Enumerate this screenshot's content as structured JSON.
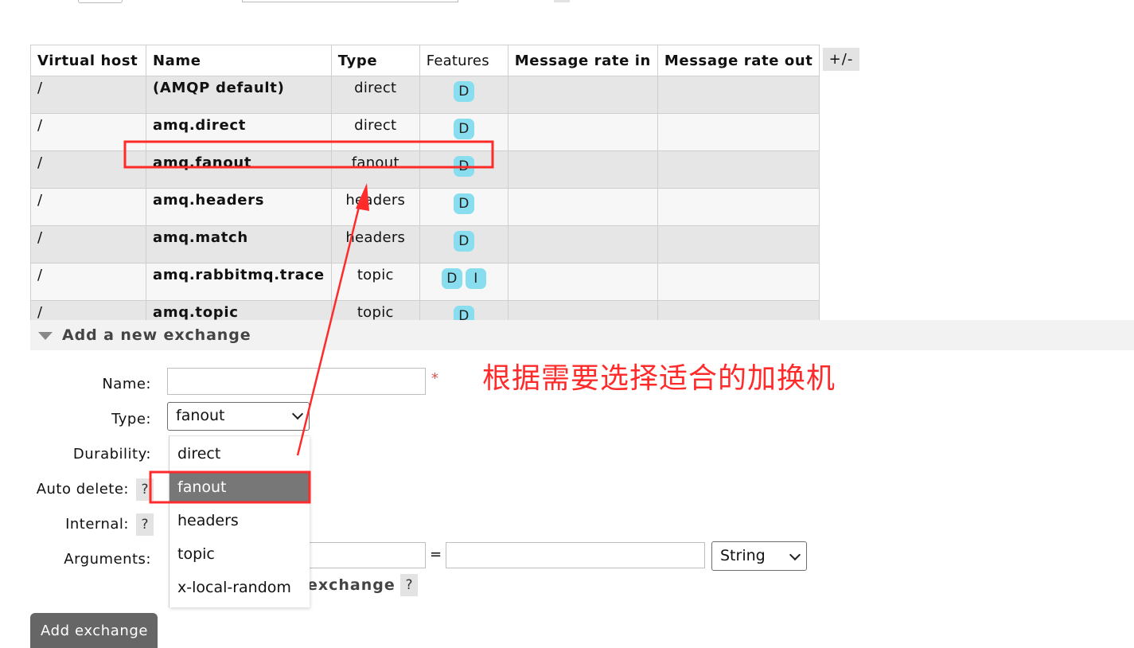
{
  "table": {
    "headers": {
      "vhost": "Virtual host",
      "name": "Name",
      "type": "Type",
      "features": "Features",
      "rate_in": "Message rate in",
      "rate_out": "Message rate out"
    },
    "columns_toggle": "+/-",
    "rows": [
      {
        "vhost": "/",
        "name": "(AMQP default)",
        "type": "direct",
        "features": [
          "D"
        ]
      },
      {
        "vhost": "/",
        "name": "amq.direct",
        "type": "direct",
        "features": [
          "D"
        ]
      },
      {
        "vhost": "/",
        "name": "amq.fanout",
        "type": "fanout",
        "features": [
          "D"
        ]
      },
      {
        "vhost": "/",
        "name": "amq.headers",
        "type": "headers",
        "features": [
          "D"
        ]
      },
      {
        "vhost": "/",
        "name": "amq.match",
        "type": "headers",
        "features": [
          "D"
        ]
      },
      {
        "vhost": "/",
        "name": "amq.rabbitmq.trace",
        "type": "topic",
        "features": [
          "D",
          "I"
        ]
      },
      {
        "vhost": "/",
        "name": "amq.topic",
        "type": "topic",
        "features": [
          "D"
        ]
      }
    ]
  },
  "add_exchange": {
    "section_title": "Add a new exchange",
    "name_label": "Name:",
    "name_value": "",
    "required_mark": "*",
    "type_label": "Type:",
    "type_value": "fanout",
    "type_options": [
      "direct",
      "fanout",
      "headers",
      "topic",
      "x-local-random"
    ],
    "durability_label": "Durability:",
    "auto_delete_label": "Auto delete:",
    "internal_label": "Internal:",
    "help_mark": "?",
    "arguments_label": "Arguments:",
    "arg_equals": "=",
    "arg_type_value": "String",
    "bind_link": "exchange",
    "submit_label": "Add exchange"
  },
  "annotation": {
    "text": "根据需要选择适合的加换机",
    "color": "#ff2a2a"
  },
  "colors": {
    "badge": "#88ddee",
    "row_odd": "#e6e6e6",
    "row_even": "#f7f7f7",
    "button": "#666666",
    "dropdown_selected": "#777777"
  }
}
